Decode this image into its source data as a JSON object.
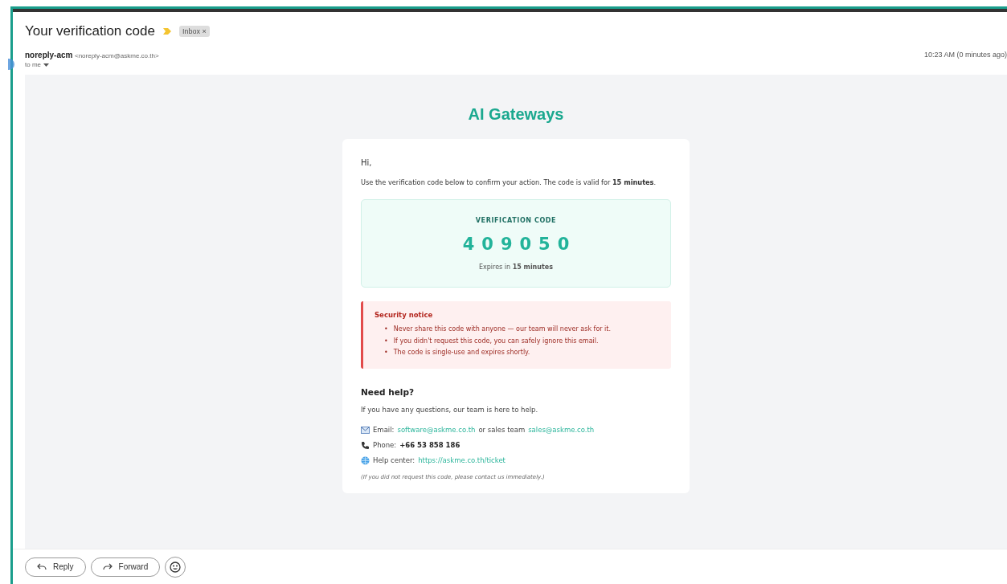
{
  "subject": "Your verification code",
  "label_chip": "Inbox",
  "label_chip_close": "×",
  "sender": {
    "name": "noreply-acm",
    "address": "<noreply-acm@askme.co.th>",
    "recipient": "to me",
    "time": "10:23 AM (0 minutes ago)"
  },
  "email": {
    "brand": "AI Gateways",
    "greeting": "Hi,",
    "intro": "Use the verification code below to confirm your action. The code is valid for **15 minutes**.",
    "code_box": {
      "label": "VERIFICATION CODE",
      "code": "409050",
      "expiry": "Expires in **15 minutes**"
    },
    "notice": {
      "title": "Security notice",
      "items": [
        {
          "bullet": "•",
          "text": "Never share this code with anyone — our team will never ask for it."
        },
        {
          "bullet": "•",
          "text": "If you didn't request this code, you can safely ignore this email."
        },
        {
          "bullet": "•",
          "text": "The code is single-use and expires shortly."
        }
      ]
    },
    "help": {
      "title": "Need help?",
      "text": "If you have any questions, our team is here to help.",
      "contacts": [
        {
          "kind": "email",
          "label": "Email:",
          "parts": [
            {
              "kind": "link",
              "text": "software@askme.co.th"
            },
            {
              "kind": "plain",
              "text": "or sales team"
            },
            {
              "kind": "link",
              "text": "sales@askme.co.th"
            }
          ]
        },
        {
          "kind": "phone",
          "label": "Phone:",
          "parts": [
            {
              "kind": "bold",
              "text": "+66 53 858 186"
            }
          ]
        },
        {
          "kind": "web",
          "label": "Help center:",
          "parts": [
            {
              "kind": "link",
              "text": "https://askme.co.th/ticket"
            }
          ]
        }
      ],
      "footnote": "(If you did not request this code, please contact us immediately.)"
    }
  },
  "actions": [
    {
      "kind": "reply",
      "label": "Reply"
    },
    {
      "kind": "forward",
      "label": "Forward"
    },
    {
      "kind": "emoji"
    }
  ]
}
